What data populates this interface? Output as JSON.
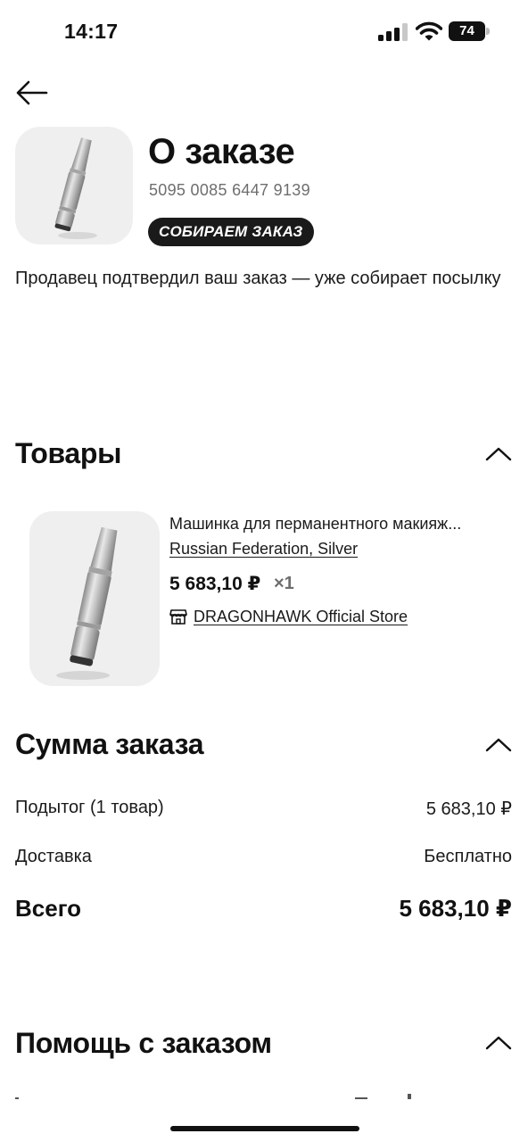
{
  "status_bar": {
    "time": "14:17",
    "battery": "74",
    "icons": [
      "signal-icon",
      "wifi-icon",
      "battery-icon"
    ]
  },
  "header": {
    "back_icon": "arrow-left-icon",
    "title": "О заказе",
    "order_number": "5095 0085 6447 9139",
    "status_badge": "СОБИРАЕМ ЗАКАЗ",
    "status_description": "Продавец подтвердил ваш заказ — уже собирает посылку"
  },
  "products_section": {
    "title": "Товары",
    "toggle_icon": "chevron-up-icon",
    "items": [
      {
        "title": "Машинка для перманентного макияж...",
        "variant": "Russian Federation, Silver",
        "price": "5 683,10 ₽",
        "quantity": "×1",
        "store_icon": "store-icon",
        "store": "DRAGONHAWK Official Store"
      }
    ]
  },
  "summary_section": {
    "title": "Сумма заказа",
    "toggle_icon": "chevron-up-icon",
    "subtotal_label": "Подытог (1 товар)",
    "subtotal_value": "5 683,10 ₽",
    "delivery_label": "Доставка",
    "delivery_value": "Бесплатно",
    "total_label": "Всего",
    "total_value": "5 683,10 ₽"
  },
  "help_section": {
    "title": "Помощь с заказом",
    "toggle_icon": "chevron-up-icon"
  }
}
